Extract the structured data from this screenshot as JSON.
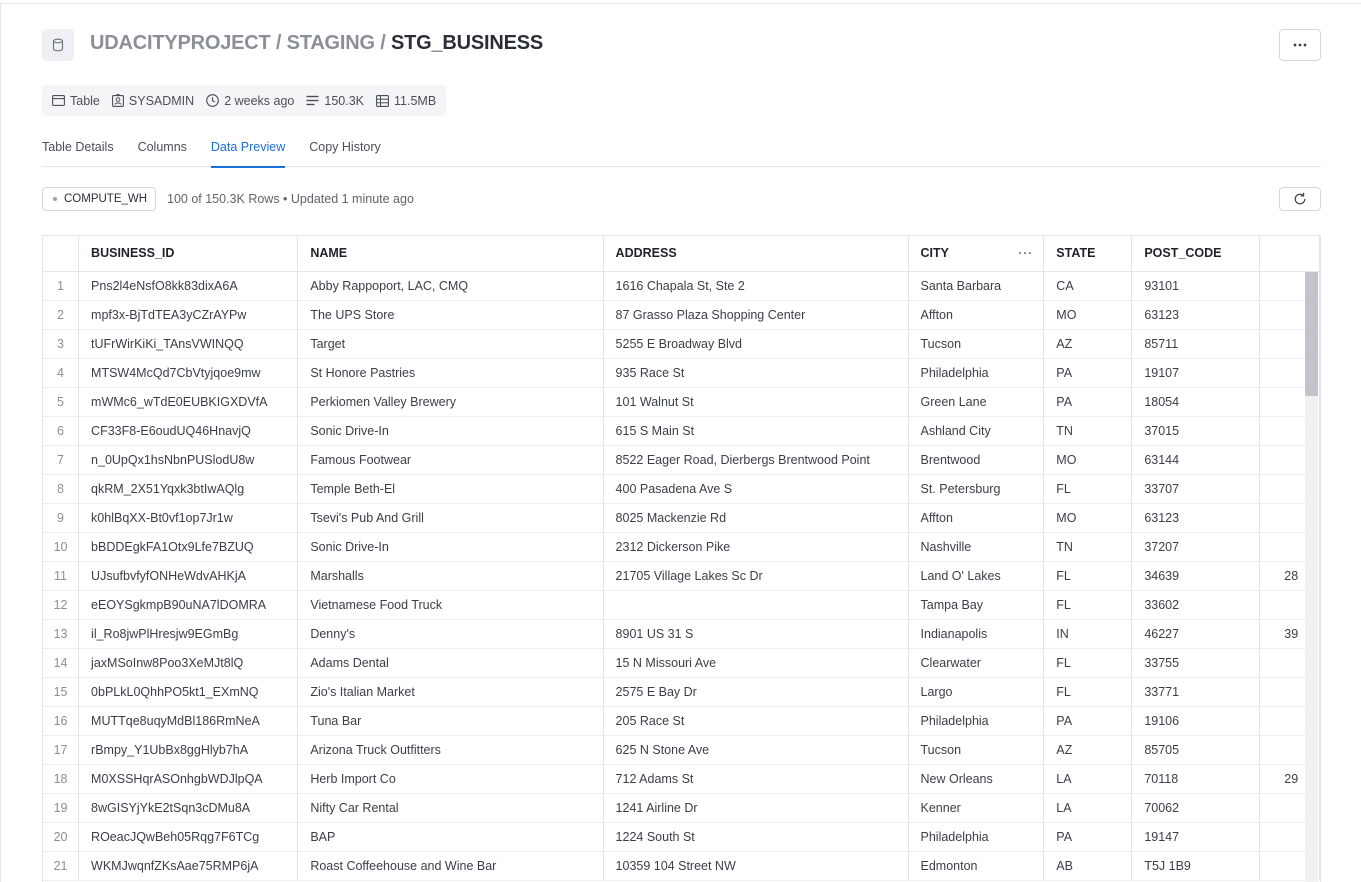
{
  "breadcrumb": {
    "database": "UDACITYPROJECT",
    "separator": " / ",
    "schema": "STAGING",
    "table": "STG_BUSINESS"
  },
  "meta": {
    "type": "Table",
    "owner": "SYSADMIN",
    "created": "2 weeks ago",
    "rows": "150.3K",
    "size": "11.5MB"
  },
  "tabs": [
    {
      "label": "Table Details",
      "active": false
    },
    {
      "label": "Columns",
      "active": false
    },
    {
      "label": "Data Preview",
      "active": true
    },
    {
      "label": "Copy History",
      "active": false
    }
  ],
  "preview": {
    "warehouse": "COMPUTE_WH",
    "status": "100 of 150.3K Rows • Updated 1 minute ago"
  },
  "columns": [
    "BUSINESS_ID",
    "NAME",
    "ADDRESS",
    "CITY",
    "STATE",
    "POST_CODE",
    ""
  ],
  "rows": [
    [
      "1",
      "Pns2l4eNsfO8kk83dixA6A",
      "Abby Rappoport, LAC, CMQ",
      "1616 Chapala St, Ste 2",
      "Santa Barbara",
      "CA",
      "93101",
      ""
    ],
    [
      "2",
      "mpf3x-BjTdTEA3yCZrAYPw",
      "The UPS Store",
      "87 Grasso Plaza Shopping Center",
      "Affton",
      "MO",
      "63123",
      ""
    ],
    [
      "3",
      "tUFrWirKiKi_TAnsVWINQQ",
      "Target",
      "5255 E Broadway Blvd",
      "Tucson",
      "AZ",
      "85711",
      ""
    ],
    [
      "4",
      "MTSW4McQd7CbVtyjqoe9mw",
      "St Honore Pastries",
      "935 Race St",
      "Philadelphia",
      "PA",
      "19107",
      ""
    ],
    [
      "5",
      "mWMc6_wTdE0EUBKIGXDVfA",
      "Perkiomen Valley Brewery",
      "101 Walnut St",
      "Green Lane",
      "PA",
      "18054",
      ""
    ],
    [
      "6",
      "CF33F8-E6oudUQ46HnavjQ",
      "Sonic Drive-In",
      "615 S Main St",
      "Ashland City",
      "TN",
      "37015",
      ""
    ],
    [
      "7",
      "n_0UpQx1hsNbnPUSlodU8w",
      "Famous Footwear",
      "8522 Eager Road, Dierbergs Brentwood Point",
      "Brentwood",
      "MO",
      "63144",
      ""
    ],
    [
      "8",
      "qkRM_2X51Yqxk3btIwAQlg",
      "Temple Beth-El",
      "400 Pasadena Ave S",
      "St. Petersburg",
      "FL",
      "33707",
      ""
    ],
    [
      "9",
      "k0hlBqXX-Bt0vf1op7Jr1w",
      "Tsevi's Pub And Grill",
      "8025 Mackenzie Rd",
      "Affton",
      "MO",
      "63123",
      ""
    ],
    [
      "10",
      "bBDDEgkFA1Otx9Lfe7BZUQ",
      "Sonic Drive-In",
      "2312 Dickerson Pike",
      "Nashville",
      "TN",
      "37207",
      ""
    ],
    [
      "11",
      "UJsufbvfyfONHeWdvAHKjA",
      "Marshalls",
      "21705 Village Lakes Sc Dr",
      "Land O' Lakes",
      "FL",
      "34639",
      "28"
    ],
    [
      "12",
      "eEOYSgkmpB90uNA7lDOMRA",
      "Vietnamese Food Truck",
      "",
      "Tampa Bay",
      "FL",
      "33602",
      ""
    ],
    [
      "13",
      "il_Ro8jwPlHresjw9EGmBg",
      "Denny's",
      "8901 US 31 S",
      "Indianapolis",
      "IN",
      "46227",
      "39"
    ],
    [
      "14",
      "jaxMSoInw8Poo3XeMJt8lQ",
      "Adams Dental",
      "15 N Missouri Ave",
      "Clearwater",
      "FL",
      "33755",
      ""
    ],
    [
      "15",
      "0bPLkL0QhhPO5kt1_EXmNQ",
      "Zio's Italian Market",
      "2575 E Bay Dr",
      "Largo",
      "FL",
      "33771",
      ""
    ],
    [
      "16",
      "MUTTqe8uqyMdBl186RmNeA",
      "Tuna Bar",
      "205 Race St",
      "Philadelphia",
      "PA",
      "19106",
      ""
    ],
    [
      "17",
      "rBmpy_Y1UbBx8ggHlyb7hA",
      "Arizona Truck Outfitters",
      "625 N Stone Ave",
      "Tucson",
      "AZ",
      "85705",
      ""
    ],
    [
      "18",
      "M0XSSHqrASOnhgbWDJlpQA",
      "Herb Import Co",
      "712 Adams St",
      "New Orleans",
      "LA",
      "70118",
      "29"
    ],
    [
      "19",
      "8wGISYjYkE2tSqn3cDMu8A",
      "Nifty Car Rental",
      "1241 Airline Dr",
      "Kenner",
      "LA",
      "70062",
      ""
    ],
    [
      "20",
      "ROeacJQwBeh05Rqg7F6TCg",
      "BAP",
      "1224 South St",
      "Philadelphia",
      "PA",
      "19147",
      ""
    ],
    [
      "21",
      "WKMJwqnfZKsAae75RMP6jA",
      "Roast Coffeehouse and Wine Bar",
      "10359 104 Street NW",
      "Edmonton",
      "AB",
      "T5J 1B9",
      ""
    ]
  ],
  "icons": {
    "database": "database-icon",
    "more": "more-horizontal-icon",
    "refresh": "refresh-icon",
    "column_menu": "column-menu-icon"
  },
  "colors": {
    "accent": "#1a6fd8",
    "muted_text": "#8a8f98"
  }
}
